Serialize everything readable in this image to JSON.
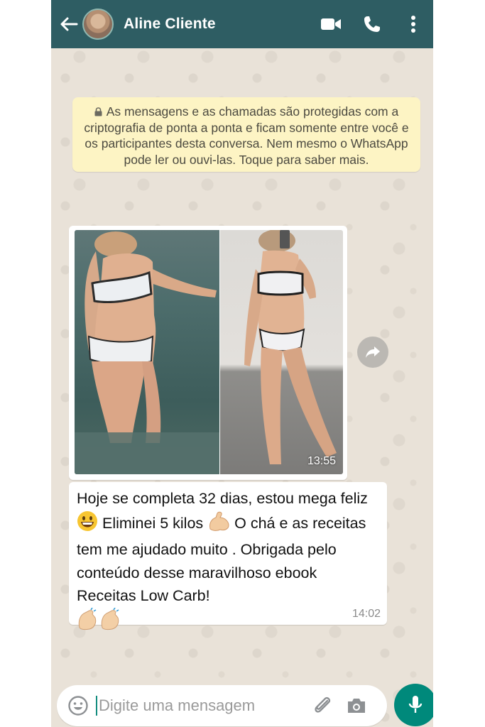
{
  "header": {
    "contact_name": "Aline Cliente"
  },
  "encryption_notice": {
    "text": "As mensagens e as chamadas são protegidas com a criptografia de ponta a ponta e ficam somente entre você e os participantes desta conversa. Nem mesmo o WhatsApp pode ler ou ouvi-las. Toque para saber mais."
  },
  "messages": [
    {
      "type": "image",
      "time": "13:55"
    },
    {
      "type": "text",
      "part1": "Hoje se completa 32 dias, estou mega feliz",
      "part2": " Eliminei 5 kilos",
      "part3": " O chá e as receitas tem me ajudado muito . Obrigada pelo conteúdo desse maravilhoso ebook Receitas Low Carb!",
      "emoji_1": "grinning-face",
      "emoji_2": "flexed-biceps",
      "emoji_3": "clapping-hands",
      "time": "14:02"
    }
  ],
  "composer": {
    "placeholder": "Digite uma mensagem"
  },
  "colors": {
    "header": "#2e5d63",
    "accent": "#00897b",
    "notice_bg": "#fdf4c4",
    "chat_bg": "#ece5dd"
  },
  "icons": [
    "back-arrow-icon",
    "video-call-icon",
    "phone-icon",
    "more-vertical-icon",
    "lock-icon",
    "forward-icon",
    "emoji-icon",
    "attach-icon",
    "camera-icon",
    "mic-icon"
  ]
}
